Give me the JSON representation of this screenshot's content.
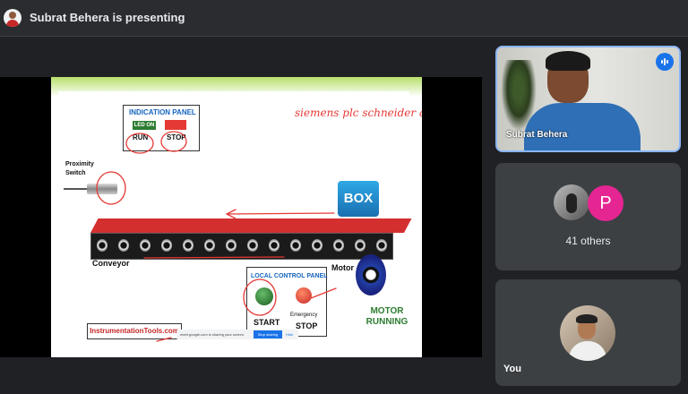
{
  "topbar": {
    "presenter_text": "Subrat Behera is presenting"
  },
  "slide": {
    "indication_panel": {
      "title": "INDICATION PANEL",
      "led_on": "LED ON",
      "run": "RUN",
      "stop": "STOP"
    },
    "proximity": {
      "label": "Proximity Switch"
    },
    "box_label": "BOX",
    "conveyor_label": "Conveyor",
    "motor": {
      "label": "Motor",
      "status": "MOTOR RUNNING"
    },
    "local_panel": {
      "title": "LOCAL CONTROL   PANEL",
      "start": "START",
      "emergency": "Emergency",
      "stop": "STOP"
    },
    "brand": "InstrumentationTools.com",
    "share_bar": {
      "text": "meet.google.com is sharing your screen.",
      "stop_button": "Stop sharing",
      "hide": "Hide"
    },
    "handwriting": "siemens plc schneider ab."
  },
  "tiles": {
    "presenter_name": "Subrat Behera",
    "others": {
      "initial": "P",
      "count_text": "41 others"
    },
    "you_label": "You"
  },
  "colors": {
    "background": "#202124",
    "tile": "#3c4043",
    "accent": "#8ab4f8",
    "p_avatar": "#e52592",
    "annotation": "#e53935"
  },
  "icons": [
    "user-avatar-icon",
    "mic-activity-icon",
    "motor-icon",
    "proximity-sensor-icon"
  ]
}
